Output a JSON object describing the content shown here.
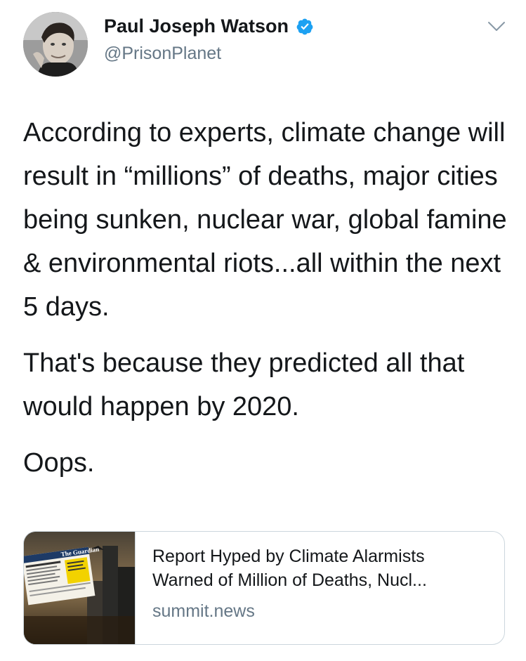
{
  "author": {
    "display_name": "Paul Joseph Watson",
    "handle": "@PrisonPlanet",
    "verified": true
  },
  "icons": {
    "verified": "verified-badge-icon",
    "menu": "chevron-down-icon"
  },
  "colors": {
    "verified_blue": "#1da1f2",
    "secondary_text": "#657786",
    "card_border": "#ccd6dd"
  },
  "tweet": {
    "paragraphs": [
      "According to experts, climate change will result in “millions” of deaths, major cities being sunken, nuclear war, global famine & environmental riots...all within the next 5 days.",
      "That's because they predicted all that would happen by 2020.",
      "Oops."
    ]
  },
  "link_card": {
    "title_line1": "Report Hyped by Climate Alarmists",
    "title_line2": "Warned of Million of Deaths, Nucl...",
    "domain": "summit.news",
    "thumbnail_masthead": "The Guardian"
  }
}
